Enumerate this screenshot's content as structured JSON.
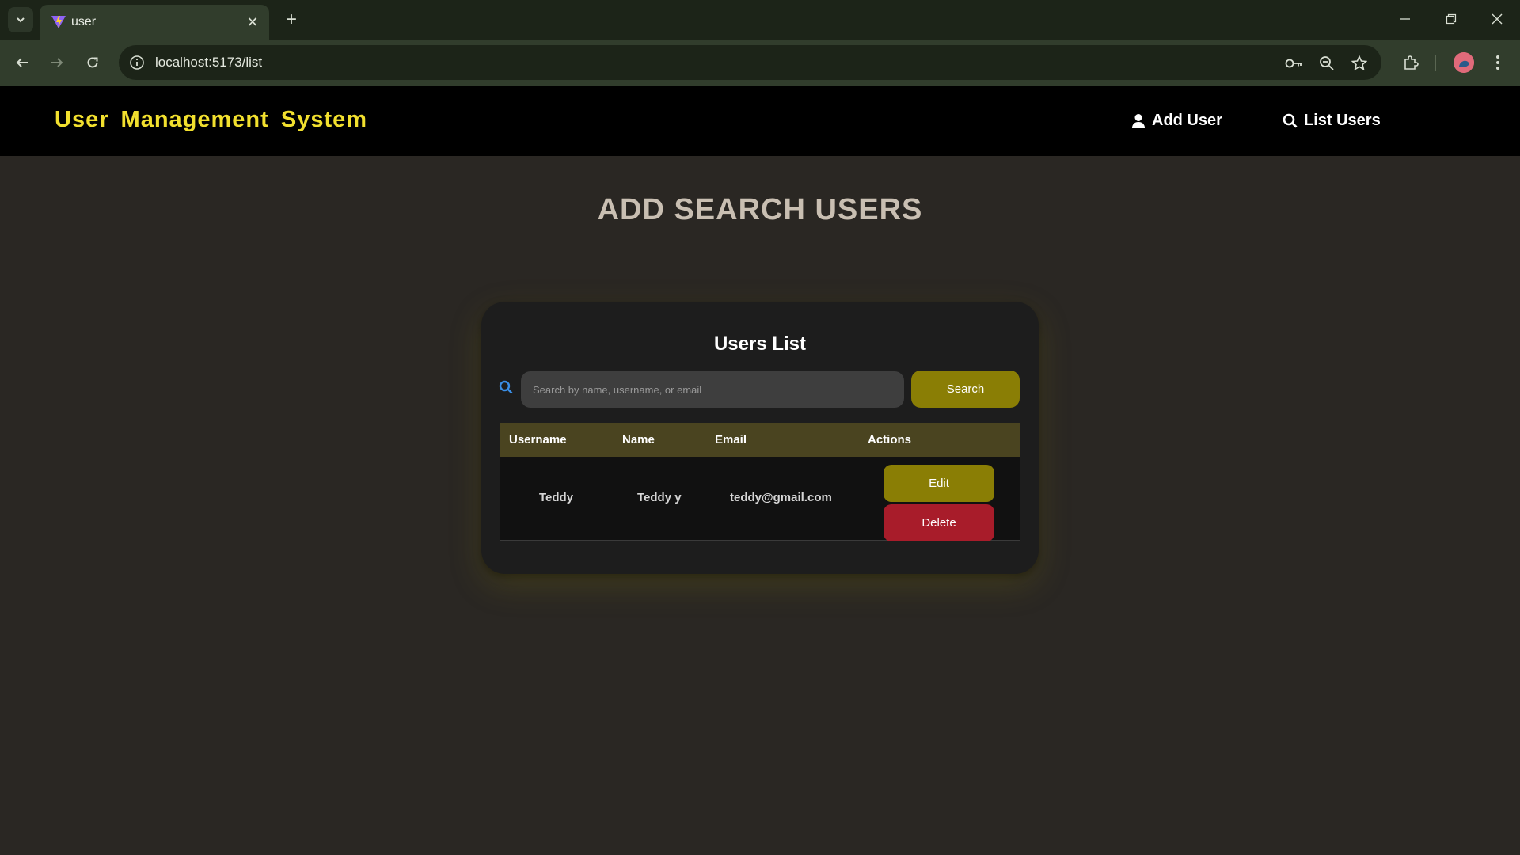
{
  "browser": {
    "tab_title": "user",
    "url": "localhost:5173/list"
  },
  "header": {
    "brand": "User Management System",
    "nav": [
      {
        "label": "Add User",
        "icon": "user-icon"
      },
      {
        "label": "List Users",
        "icon": "search-icon"
      }
    ]
  },
  "page": {
    "heading": "ADD SEARCH USERS"
  },
  "users_card": {
    "title": "Users List",
    "search_placeholder": "Search by name, username, or email",
    "search_button": "Search",
    "columns": [
      "Username",
      "Name",
      "Email",
      "Actions"
    ],
    "rows": [
      {
        "username": "Teddy",
        "name": "Teddy y",
        "email": "teddy@gmail.com"
      }
    ],
    "edit_label": "Edit",
    "delete_label": "Delete"
  },
  "colors": {
    "brand": "#f2e02e",
    "accent": "#8a7e05",
    "danger": "#a81c2a",
    "search_icon": "#3a8ee6"
  }
}
